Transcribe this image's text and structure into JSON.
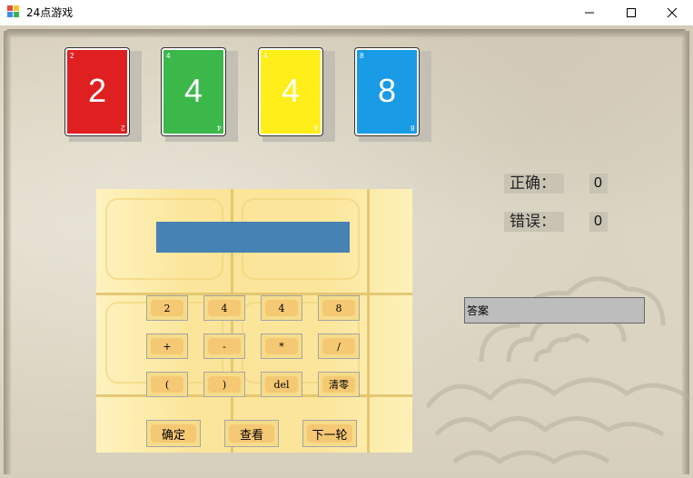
{
  "window": {
    "title": "24点游戏",
    "controls": [
      "minimize",
      "maximize",
      "close"
    ]
  },
  "cards": [
    {
      "value": "2",
      "color": "#e02020"
    },
    {
      "value": "4",
      "color": "#3cb84a"
    },
    {
      "value": "4",
      "color": "#ffee1a"
    },
    {
      "value": "8",
      "color": "#1a9be6"
    }
  ],
  "score": {
    "correct_label": "正确：",
    "correct_value": "0",
    "wrong_label": "错误：",
    "wrong_value": "0"
  },
  "answer": {
    "text": "答案"
  },
  "calculator": {
    "display": "",
    "number_buttons": [
      "2",
      "4",
      "4",
      "8"
    ],
    "operator_buttons": [
      "+",
      "-",
      "*",
      "/"
    ],
    "misc_buttons": [
      "(",
      ")",
      "del",
      "清零"
    ],
    "action_buttons": {
      "confirm": "确定",
      "view": "查看",
      "next": "下一轮"
    }
  },
  "colors": {
    "display_bg": "#4682b4",
    "panel_bg": "#fbe59a"
  }
}
